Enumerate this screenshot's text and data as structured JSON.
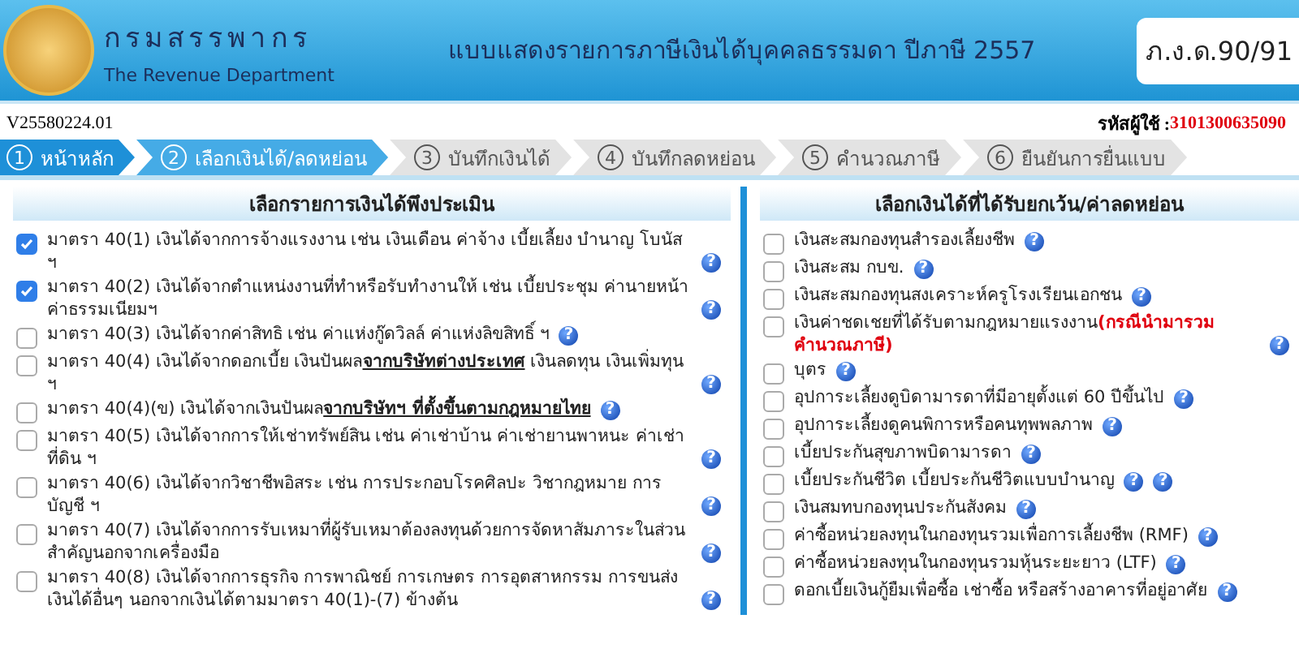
{
  "header": {
    "org_name": "กรมสรรพากร",
    "org_name_en": "The Revenue Department",
    "title": "แบบแสดงรายการภาษีเงินได้บุคคลธรรมดา ปีภาษี 2557",
    "form_code": "ภ.ง.ด.90/91"
  },
  "info_bar": {
    "version": "V25580224.01",
    "user_label": "รหัสผู้ใช้ :",
    "user_id": "3101300635090"
  },
  "steps": [
    {
      "number": "1",
      "label": "หน้าหลัก",
      "reached": true,
      "selected": false
    },
    {
      "number": "2",
      "label": "เลือกเงินได้/ลดหย่อน",
      "reached": true,
      "selected": true
    },
    {
      "number": "3",
      "label": "บันทึกเงินได้",
      "reached": false,
      "selected": false
    },
    {
      "number": "4",
      "label": "บันทึกลดหย่อน",
      "reached": false,
      "selected": false
    },
    {
      "number": "5",
      "label": "คำนวณภาษี",
      "reached": false,
      "selected": false
    },
    {
      "number": "6",
      "label": "ยืนยันการยื่นแบบ",
      "reached": false,
      "selected": false
    }
  ],
  "income_panel": {
    "title": "เลือกรายการเงินได้พึงประเมิน",
    "items": [
      {
        "text": "มาตรา 40(1) เงินได้จากการจ้างแรงงาน เช่น เงินเดือน ค่าจ้าง เบี้ยเลี้ยง บำนาญ โบนัส ฯ",
        "checked": true,
        "help": [
          "?"
        ]
      },
      {
        "text": "มาตรา 40(2) เงินได้จากตำแหน่งงานที่ทำหรือรับทำงานให้ เช่น เบี้ยประชุม ค่านายหน้า ค่าธรรมเนียมฯ",
        "checked": true,
        "help": [
          "?"
        ]
      },
      {
        "text": "มาตรา 40(3) เงินได้จากค่าสิทธิ เช่น ค่าแห่งกู๊ดวิลล์ ค่าแห่งลิขสิทธิ์ ฯ",
        "checked": false,
        "help": [
          "?"
        ]
      },
      {
        "text": "มาตรา 40(4) เงินได้จากดอกเบี้ย เงินปันผล**จากบริษัทต่างประเทศ** เงินลดทุน เงินเพิ่มทุน ฯ",
        "checked": false,
        "help": [
          "?"
        ]
      },
      {
        "text": "มาตรา 40(4)(ข) เงินได้จากเงินปันผล**จากบริษัทฯ ที่ตั้งขึ้นตามกฎหมายไทย**",
        "checked": false,
        "help": [
          "?"
        ]
      },
      {
        "text": "มาตรา 40(5) เงินได้จากการให้เช่าทรัพย์สิน เช่น ค่าเช่าบ้าน ค่าเช่ายานพาหนะ ค่าเช่าที่ดิน ฯ",
        "checked": false,
        "help": [
          "?"
        ]
      },
      {
        "text": "มาตรา 40(6) เงินได้จากวิชาชีพอิสระ เช่น การประกอบโรคศิลปะ วิชากฎหมาย การบัญชี ฯ",
        "checked": false,
        "help": [
          "?"
        ]
      },
      {
        "text": "มาตรา 40(7) เงินได้จากการรับเหมาที่ผู้รับเหมาต้องลงทุนด้วยการจัดหาสัมภาระในส่วนสำคัญนอกจากเครื่องมือ",
        "checked": false,
        "help": [
          "?"
        ]
      },
      {
        "text": "มาตรา 40(8) เงินได้จากการธุรกิจ การพาณิชย์ การเกษตร การอุตสาหกรรม การขนส่ง เงินได้อื่นๆ นอกจากเงินได้ตามมาตรา 40(1)-(7) ข้างต้น",
        "checked": false,
        "help": [
          "?"
        ]
      }
    ]
  },
  "deduction_panel": {
    "title": "เลือกเงินได้ที่ได้รับยกเว้น/ค่าลดหย่อน",
    "items": [
      {
        "text": "เงินสะสมกองทุนสำรองเลี้ยงชีพ",
        "checked": false,
        "help": [
          "?"
        ]
      },
      {
        "text": "เงินสะสม กบข.",
        "checked": false,
        "help": [
          "?"
        ]
      },
      {
        "text": "เงินสะสมกองทุนสงเคราะห์ครูโรงเรียนเอกชน",
        "checked": false,
        "help": [
          "?"
        ]
      },
      {
        "text": "เงินค่าชดเชยที่ได้รับตามกฎหมายแรงงาน",
        "note": "(กรณีนำมารวมคำนวณภาษี)",
        "checked": false,
        "help": [
          "?"
        ]
      },
      {
        "text": "บุตร",
        "checked": false,
        "help": [
          "?"
        ]
      },
      {
        "text": "อุปการะเลี้ยงดูบิดามารดาที่มีอายุตั้งแต่ 60 ปีขึ้นไป",
        "checked": false,
        "help": [
          "?"
        ]
      },
      {
        "text": "อุปการะเลี้ยงดูคนพิการหรือคนทุพพลภาพ",
        "checked": false,
        "help": [
          "?"
        ]
      },
      {
        "text": "เบี้ยประกันสุขภาพบิดามารดา",
        "checked": false,
        "help": [
          "?"
        ]
      },
      {
        "text": "เบี้ยประกันชีวิต เบี้ยประกันชีวิตแบบบำนาญ",
        "checked": false,
        "help": [
          "?",
          "?"
        ]
      },
      {
        "text": "เงินสมทบกองทุนประกันสังคม",
        "checked": false,
        "help": [
          "?"
        ]
      },
      {
        "text": "ค่าซื้อหน่วยลงทุนในกองทุนรวมเพื่อการเลี้ยงชีพ (RMF)",
        "checked": false,
        "help": [
          "?"
        ]
      },
      {
        "text": "ค่าซื้อหน่วยลงทุนในกองทุนรวมหุ้นระยะยาว (LTF)",
        "checked": false,
        "help": [
          "?"
        ]
      },
      {
        "text": "ดอกเบี้ยเงินกู้ยืมเพื่อซื้อ เช่าซื้อ หรือสร้างอาคารที่อยู่อาศัย",
        "checked": false,
        "help": [
          "?"
        ]
      }
    ]
  }
}
